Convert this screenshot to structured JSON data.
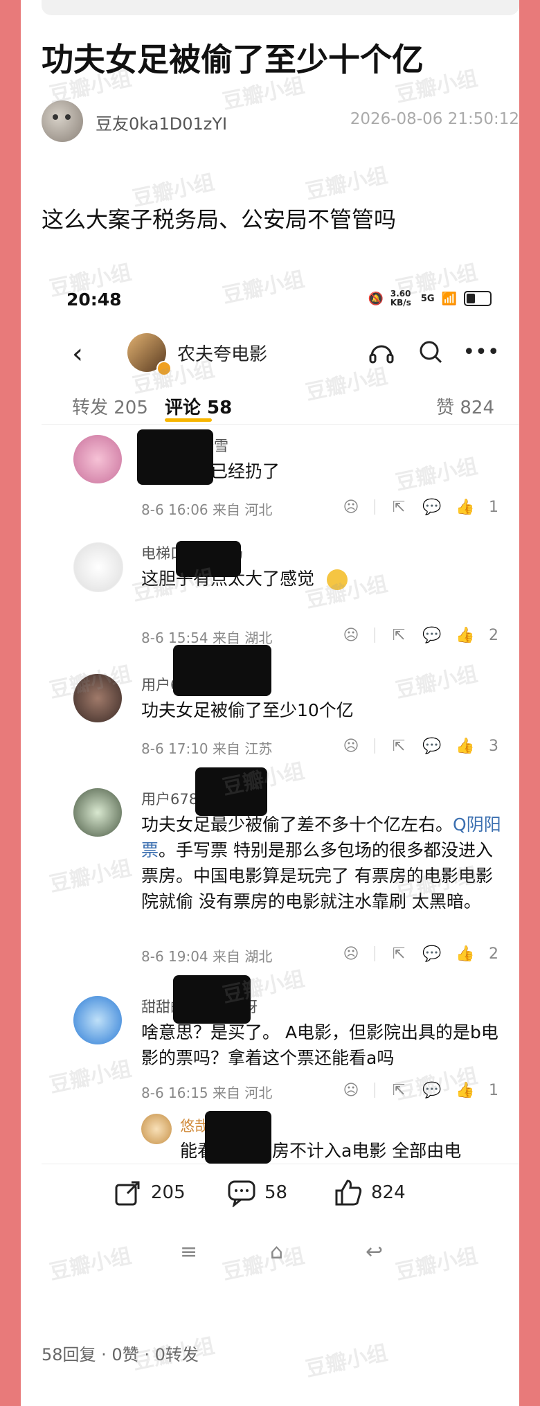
{
  "post": {
    "title": "功夫女足被偷了至少十个亿",
    "author": "豆友0ka1D01zYI",
    "time": "2026-08-06 21:50:12",
    "body": "这么大案子税务局、公安局不管管吗",
    "footer": "58回复 · 0赞 · 0转发"
  },
  "watermark": "豆瓣小组",
  "screenshot": {
    "status_time": "20:48",
    "net_speed": "3.60 KB/s",
    "signal": "5G",
    "account_name": "农夫夸电影",
    "tabs": {
      "repost": "转发 205",
      "comments": "评论 58",
      "likes": "赞 824"
    },
    "comments": [
      {
        "user": "不见彩不盼雪",
        "text": "看完了票已经扔了",
        "meta": "8-6 16:06 来自 河北",
        "likes": "1"
      },
      {
        "user": "电梯口的老奶奶",
        "text": "这胆子有点太大了感觉",
        "meta": "8-6 15:54 来自 湖北",
        "likes": "2"
      },
      {
        "user": "用户6508084345",
        "text": "功夫女足被偷了至少10个亿",
        "meta": "8-6 17:10 来自 江苏",
        "likes": "3"
      },
      {
        "user": "用户6783408610",
        "text_before": "功夫女足最少被偷了差不多十个亿左右。",
        "tag": "Q阴阳票",
        "text_after": "。手写票  特别是那么多包场的很多都没进入票房。中国电影算是玩完了  有票房的电影电影院就偷  没有票房的电影就注水靠刷  太黑暗。",
        "meta": "8-6 19:04 来自 湖北",
        "likes": "2"
      },
      {
        "user": "甜甜的味道甜甜呀",
        "text": "啥意思？是买了。 A电影，但影院出具的是b电影的票吗？拿着这个票还能看a吗",
        "meta": "8-6 16:15 来自 河北",
        "likes": "1"
      }
    ],
    "reply": {
      "user": "悠哉哉豆豆",
      "text": "能看 但是票房不计入a电影 全部由电"
    },
    "bottom": {
      "repost": "205",
      "comment": "58",
      "like": "824"
    }
  }
}
